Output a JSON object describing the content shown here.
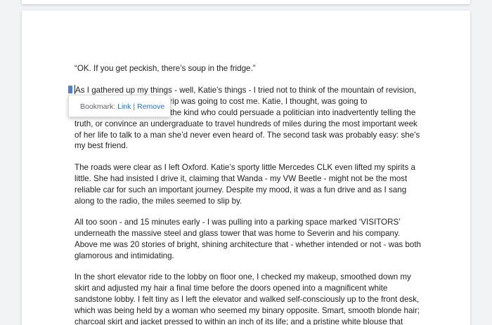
{
  "bookmark_bubble": {
    "label": "Bookmark:",
    "link": "Link",
    "separator": "|",
    "remove": "Remove"
  },
  "paragraphs": [
    [
      "“OK. If you get peckish, there’s soup in the fridge.”"
    ],
    [
      "As I gathered up my things - well, Katie’s things - I tried not to think of the mountain of revision,",
      "es that this trip was going to cost me. Katie, I thought, was going to",
      "the kind who could persuade a politician into inadvertently telling the",
      "truth, or convince an undergraduate to travel hundreds of miles during the most important week",
      "of her life to talk to a man she’d never even heard of. The second task was probably easy: she’s",
      "my best friend."
    ],
    [
      "The roads were clear as I left Oxford. Katie’s sporty little Mercedes CLK even lifted my spirits a",
      "little. She had insisted I drive it, claiming that Wanda - my VW Beetle - might not be the most",
      "reliable car for such an important journey. Despite my mood, it was a fun drive and as I sang",
      "along to the radio, the miles seemed to slip by."
    ],
    [
      "All too soon - and 15 minutes early - I was pulling into a parking space marked ‘VISITORS’",
      "underneath the massive steel and glass tower that was home to Severin and his company.",
      "Above me was 20 stories of bright, shining architecture that - whether intended or not - was both",
      "glamorous and intimidating."
    ],
    [
      "In the short elevator ride to the lobby on floor one, I checked my makeup, smoothed down my",
      "skirt and adjusted my hair a final time before the doors opened into a magnificent white",
      "sandstone lobby. I felt tiny as I left the elevator and walked self-consciously up to the front desk,",
      "which was being held by a woman who seemed my binary opposite. Smart, smooth blonde hair;",
      "charcoal skirt and jacket pressed to within an inch of its life; and a pristine white blouse that"
    ]
  ]
}
